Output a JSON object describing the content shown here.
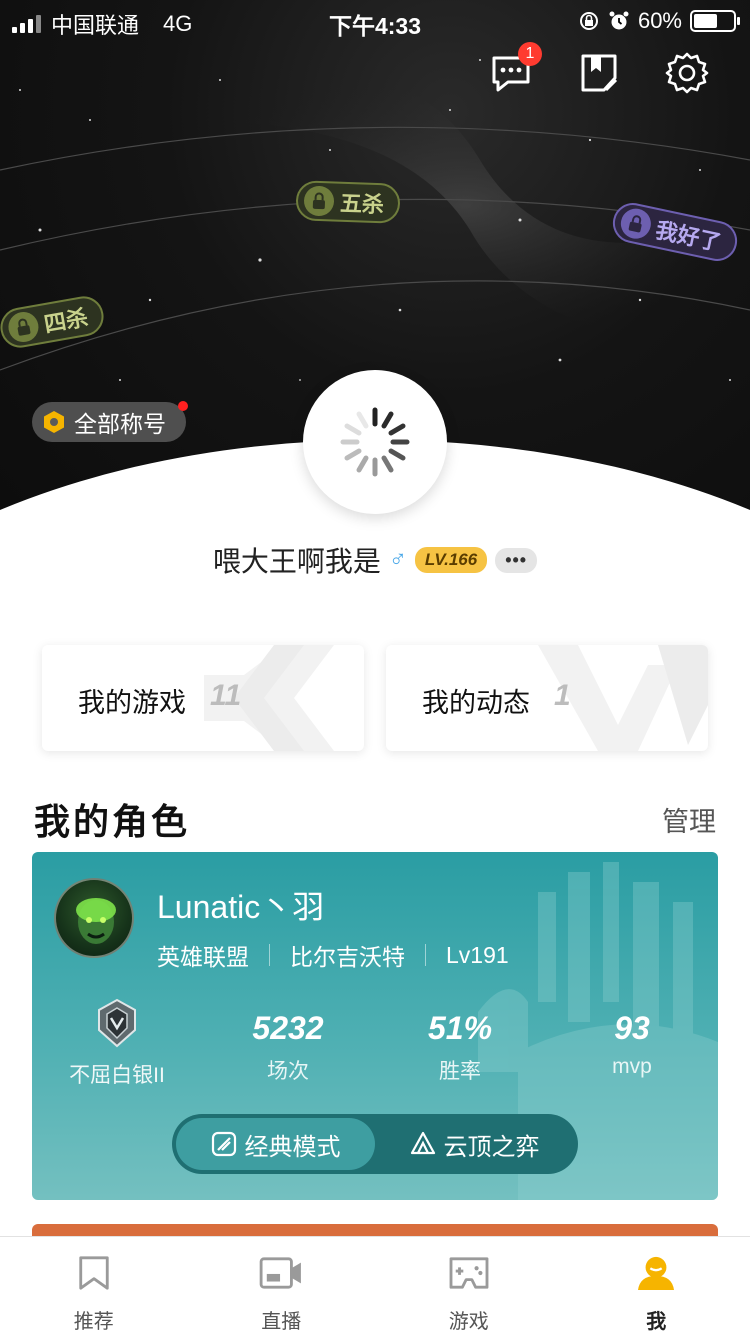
{
  "status_bar": {
    "carrier": "中国联通",
    "network": "4G",
    "time": "下午4:33",
    "battery": "60%"
  },
  "header": {
    "message_badge": "1"
  },
  "titles": {
    "pill_1": "五杀",
    "pill_2": "我好了",
    "pill_3": "四杀",
    "all_titles": "全部称号"
  },
  "profile": {
    "name": "喂大王啊我是",
    "gender_symbol": "♂",
    "level": "LV.166",
    "more": "•••"
  },
  "cards": [
    {
      "label": "我的游戏",
      "count": "11"
    },
    {
      "label": "我的动态",
      "count": "1"
    }
  ],
  "roles_section": {
    "title": "我的角色",
    "manage": "管理"
  },
  "role": {
    "name": "Lunatic丶羽",
    "game": "英雄联盟",
    "server": "比尔吉沃特",
    "level": "Lv191",
    "rank": "不屈白银II",
    "stats": [
      {
        "value": "5232",
        "label": "场次"
      },
      {
        "value": "51%",
        "label": "胜率"
      },
      {
        "value": "93",
        "label": "mvp"
      }
    ],
    "modes": [
      "经典模式",
      "云顶之弈"
    ]
  },
  "tabbar": [
    {
      "label": "推荐",
      "icon": "bookmark-icon"
    },
    {
      "label": "直播",
      "icon": "video-icon"
    },
    {
      "label": "游戏",
      "icon": "gamepad-icon"
    },
    {
      "label": "我",
      "icon": "person-icon"
    }
  ],
  "colors": {
    "accent": "#f6c343",
    "role_teal": "#2a9da3",
    "badge_red": "#ff3b30"
  }
}
